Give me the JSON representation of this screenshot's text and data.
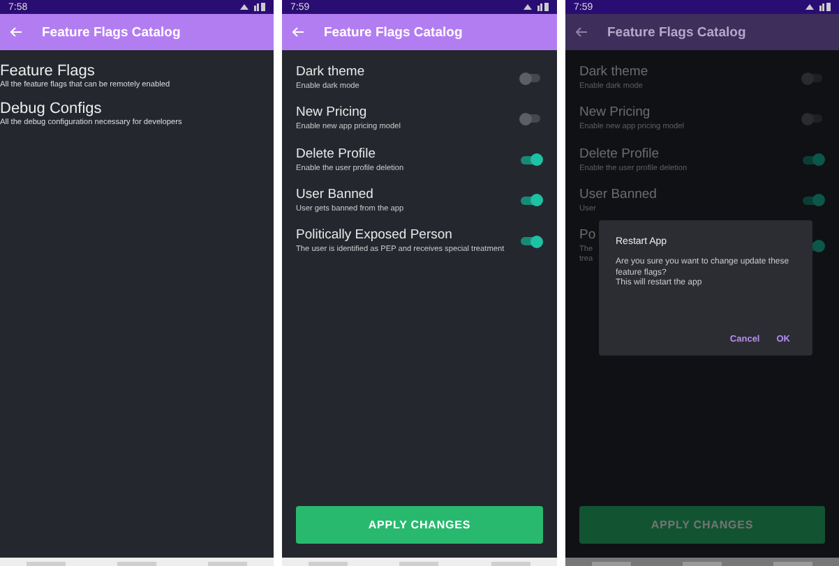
{
  "screens": [
    {
      "kind": "catalog",
      "status_time": "7:58",
      "app_bar": {
        "title": "Feature Flags Catalog"
      },
      "dimmed": false,
      "items": [
        {
          "title": "Feature Flags",
          "subtitle": "All the feature flags that can be remotely enabled"
        },
        {
          "title": "Debug Configs",
          "subtitle": "All the debug configuration necessary for developers"
        }
      ]
    },
    {
      "kind": "flags",
      "status_time": "7:59",
      "app_bar": {
        "title": "Feature Flags Catalog"
      },
      "dimmed": false,
      "flags": [
        {
          "title": "Dark theme",
          "subtitle": "Enable dark mode",
          "on": false
        },
        {
          "title": "New Pricing",
          "subtitle": "Enable new app pricing model",
          "on": false
        },
        {
          "title": "Delete Profile",
          "subtitle": "Enable the user profile deletion",
          "on": true
        },
        {
          "title": "User Banned",
          "subtitle": "User gets banned from the app",
          "on": true
        },
        {
          "title": "Politically Exposed Person",
          "subtitle": "The user is identified as PEP and receives special treatment",
          "on": true
        }
      ],
      "button": "APPLY CHANGES"
    },
    {
      "kind": "flags",
      "status_time": "7:59",
      "app_bar": {
        "title": "Feature Flags Catalog"
      },
      "dimmed": true,
      "flags": [
        {
          "title": "Dark theme",
          "subtitle": "Enable dark mode",
          "on": false
        },
        {
          "title": "New Pricing",
          "subtitle": "Enable new app pricing model",
          "on": false
        },
        {
          "title": "Delete Profile",
          "subtitle": "Enable the user profile deletion",
          "on": true
        },
        {
          "title": "User Banned",
          "subtitle": "User",
          "on": true
        },
        {
          "title": "Po",
          "subtitle": "The\ntrea",
          "on": true
        }
      ],
      "button": "APPLY CHANGES",
      "dialog": {
        "title": "Restart App",
        "message": [
          "Are you sure you want to change update these feature flags?",
          "This will restart the app"
        ],
        "actions": [
          "Cancel",
          "OK"
        ]
      }
    }
  ]
}
